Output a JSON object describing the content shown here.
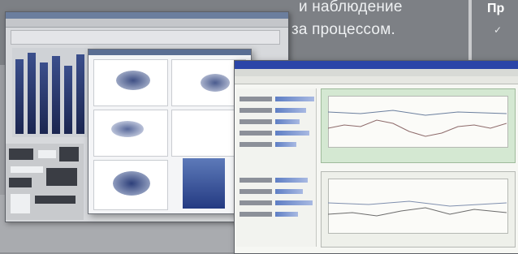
{
  "caption": {
    "line1": "и наблюдение",
    "line2": "за процессом."
  },
  "sidebar": {
    "title": "Пр",
    "bullet": "✓"
  },
  "screens": {
    "front_window": {
      "title": ""
    }
  },
  "colors": {
    "background": "#8f9195",
    "titlebar_front": "#2b45a8",
    "green_panel": "#d4e8d2",
    "bars": "#1b2650"
  }
}
